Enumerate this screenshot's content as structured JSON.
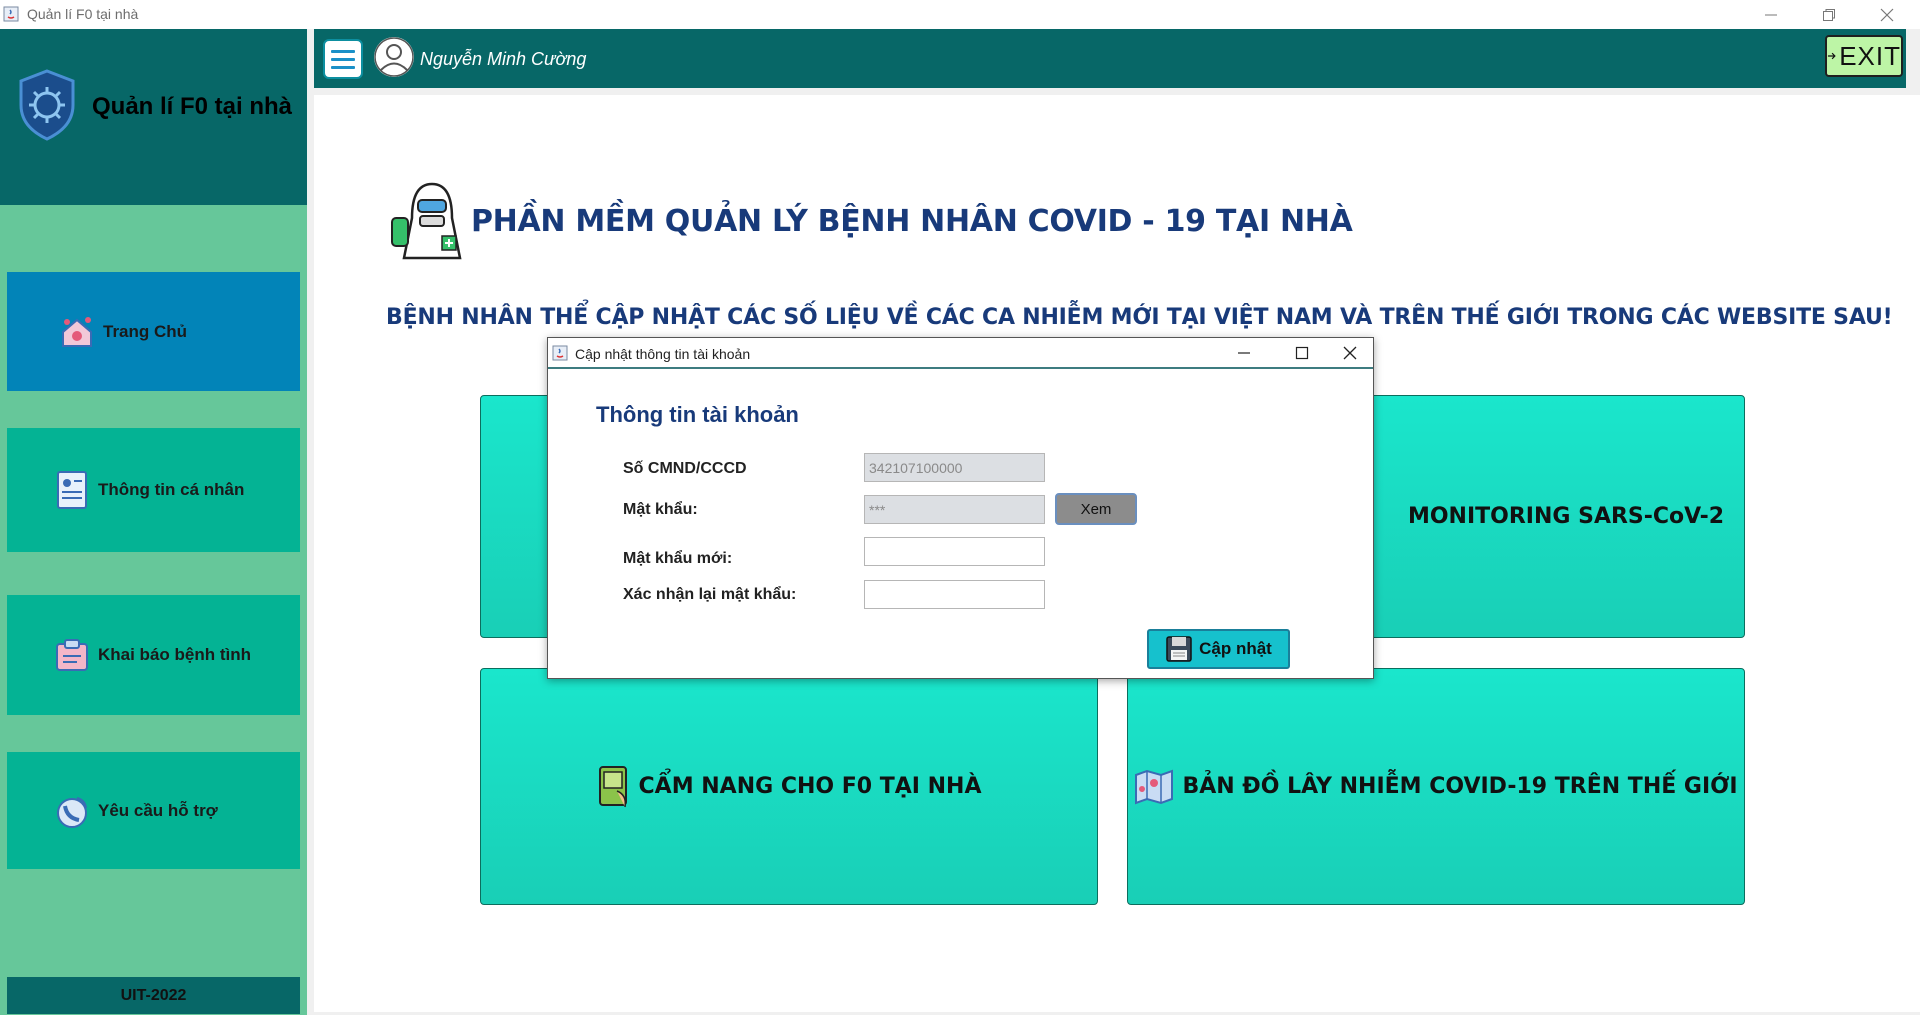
{
  "window": {
    "title": "Quản lí F0 tại nhà"
  },
  "sidebar": {
    "app_title": "Quản lí F0 tại nhà",
    "items": [
      {
        "label": "Trang Chủ",
        "icon": "home-virus-icon",
        "active": true
      },
      {
        "label": "Thông tin cá nhân",
        "icon": "profile-document-icon"
      },
      {
        "label": "Khai báo bệnh tình",
        "icon": "medical-report-icon"
      },
      {
        "label": "Yêu cầu hỗ trợ",
        "icon": "support-phone-icon"
      }
    ],
    "footer": "UIT-2022"
  },
  "header": {
    "username": "Nguyễn Minh Cường",
    "exit_label": "EXIT"
  },
  "main": {
    "title": "PHẦN MỀM QUẢN LÝ BỆNH NHÂN COVID - 19 TẠI NHÀ",
    "subtitle": "BỆNH NHÂN THỂ CẬP NHẬT CÁC SỐ LIỆU VỀ CÁC CA NHIỄM MỚI TẠI VIỆT NAM VÀ TRÊN THẾ GIỚI TRONG CÁC WEBSITE SAU!",
    "cards": [
      {
        "label": ""
      },
      {
        "label": "MONITORING SARS-CoV-2"
      },
      {
        "label": "CẨM NANG CHO F0 TẠI NHÀ"
      },
      {
        "label": "BẢN ĐỒ LÂY NHIỄM COVID-19 TRÊN THẾ GIỚI"
      }
    ]
  },
  "dialog": {
    "title": "Cập nhật thông tin tài khoản",
    "heading": "Thông tin tài khoản",
    "fields": {
      "id_label": "Số CMND/CCCD",
      "id_value": "342107100000",
      "password_label": "Mật khẩu:",
      "password_value": "***",
      "new_password_label": "Mật khẩu mới:",
      "confirm_label": "Xác nhận lại mật khẩu:"
    },
    "view_button": "Xem",
    "update_button": "Cập nhật"
  },
  "colors": {
    "sidebar_bg": "#66c79a",
    "header_bg": "#076767",
    "active_nav": "#0284b8",
    "nav_bg": "#04b394",
    "card_bg": "#1ae6cc",
    "title_text": "#183a7a"
  }
}
